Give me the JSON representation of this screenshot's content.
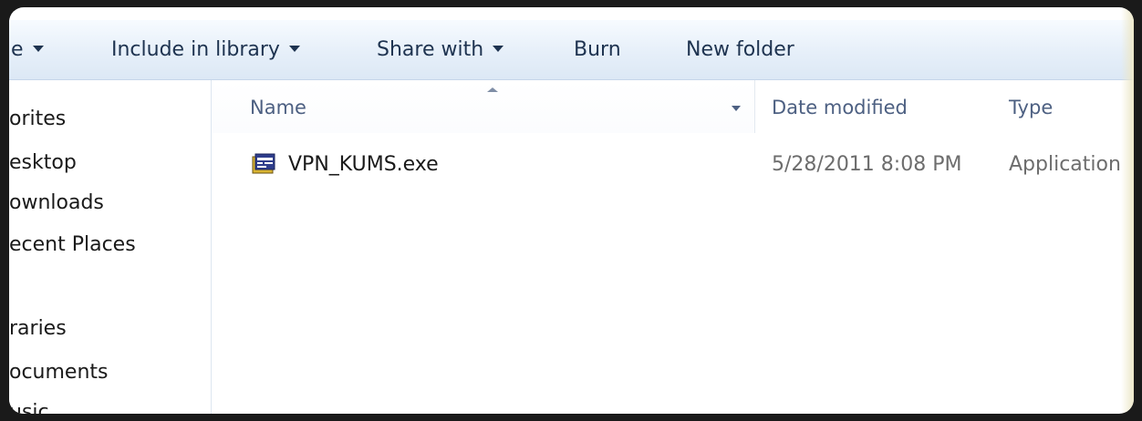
{
  "toolbar": {
    "items": [
      {
        "label": "e",
        "has_arrow": true
      },
      {
        "label": "Include in library",
        "has_arrow": true
      },
      {
        "label": "Share with",
        "has_arrow": true
      },
      {
        "label": "Burn",
        "has_arrow": false
      },
      {
        "label": "New folder",
        "has_arrow": false
      }
    ]
  },
  "nav": {
    "items": [
      {
        "label": "orites"
      },
      {
        "label": "esktop"
      },
      {
        "label": "ownloads"
      },
      {
        "label": "ecent Places"
      },
      {
        "label": "raries"
      },
      {
        "label": "ocuments"
      },
      {
        "label": "usic"
      }
    ]
  },
  "columns": {
    "name": "Name",
    "date_modified": "Date modified",
    "type": "Type"
  },
  "files": [
    {
      "name": "VPN_KUMS.exe",
      "date_modified": "5/28/2011 8:08 PM",
      "type": "Application",
      "icon": "exe-application-icon"
    }
  ],
  "colors": {
    "toolbar_text": "#1e3350",
    "header_text": "#4d6082",
    "secondary_text": "#6d6d6d",
    "body_text": "#1a1a1a"
  }
}
